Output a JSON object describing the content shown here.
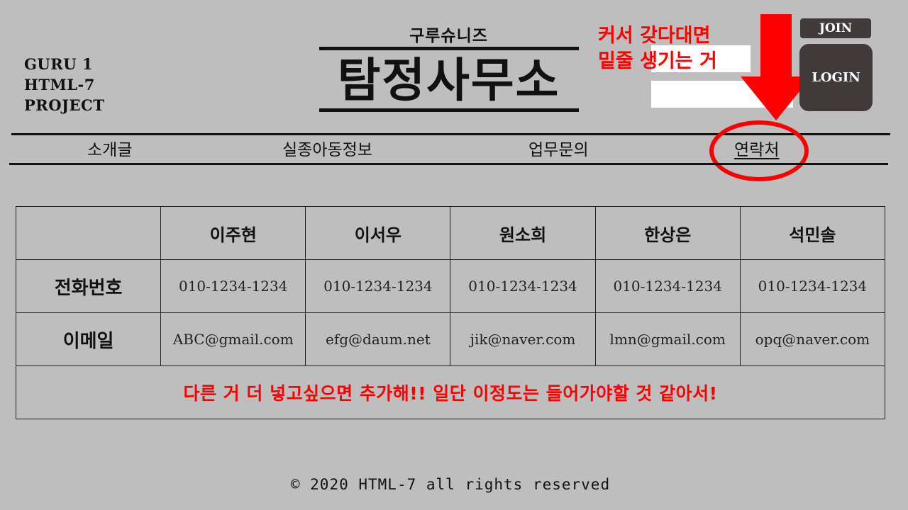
{
  "header": {
    "project_lines": [
      "GURU 1",
      "HTML-7",
      "PROJECT"
    ],
    "subtitle": "구루슈니즈",
    "title": "탐정사무소",
    "annotation_lines": [
      "커서 갖다대면",
      "밑줄 생기는 거"
    ],
    "join_label": "JOIN",
    "login_label": "LOGIN"
  },
  "nav": {
    "items": [
      {
        "label": "소개글"
      },
      {
        "label": "실종아동정보"
      },
      {
        "label": "업무문의"
      },
      {
        "label": "연락처"
      }
    ]
  },
  "table": {
    "columns": [
      "",
      "이주현",
      "이서우",
      "원소희",
      "한상은",
      "석민솔"
    ],
    "rows": [
      {
        "label": "전화번호",
        "values": [
          "010-1234-1234",
          "010-1234-1234",
          "010-1234-1234",
          "010-1234-1234",
          "010-1234-1234"
        ]
      },
      {
        "label": "이메일",
        "values": [
          "ABC@gmail.com",
          "efg@daum.net",
          "jik@naver.com",
          "lmn@gmail.com",
          "opq@naver.com"
        ]
      }
    ],
    "footnote": "다른 거 더 넣고싶으면 추가해!! 일단 이정도는 들어가야할 것 같아서!"
  },
  "footer": {
    "copyright": "© 2020 HTML-7 all rights reserved"
  },
  "colors": {
    "background": "#bebebe",
    "accent_red": "#ff0000",
    "button_dark": "#403b3a"
  }
}
